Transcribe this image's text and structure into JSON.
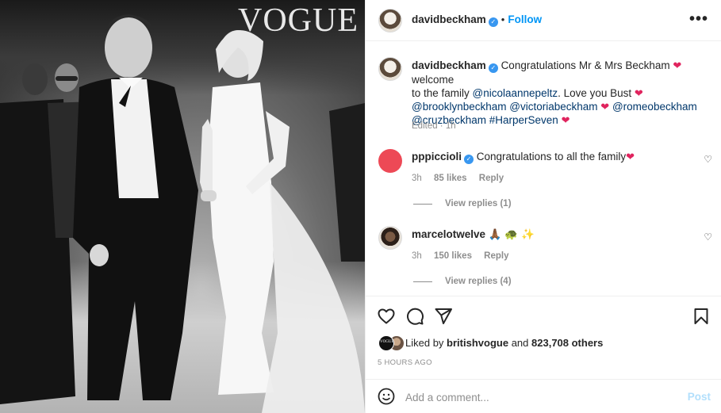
{
  "photo": {
    "watermark": "VOGUE"
  },
  "header": {
    "username": "davidbeckham",
    "separator": "•",
    "follow_label": "Follow",
    "more_label": "•••"
  },
  "caption": {
    "username": "davidbeckham",
    "text1": "Congratulations Mr & Mrs Beckham",
    "text2": "welcome",
    "text3": "to the family",
    "mention_nicola": "@nicolaannepeltz",
    "text4": ". Love you Bust",
    "mention_brooklyn": "@brooklynbeckham",
    "mention_victoria": "@victoriabeckham",
    "mention_romeo": "@romeobeckham",
    "mention_cruz": "@cruzbeckham",
    "hashtag_harper": "#HarperSeven",
    "edited": "Edited",
    "time": "1h",
    "heart": "❤"
  },
  "comments": [
    {
      "username": "pppiccioli",
      "text": "Congratulations to all the family",
      "time": "3h",
      "likes": "85 likes",
      "reply_label": "Reply",
      "view_replies": "View replies (1)"
    },
    {
      "username": "marcelotwelve",
      "text": "🙏🏾 🐢 ✨",
      "time": "3h",
      "likes": "150 likes",
      "reply_label": "Reply",
      "view_replies": "View replies (4)"
    }
  ],
  "likes": {
    "prefix": "Liked by",
    "user": "britishvogue",
    "and": "and",
    "others": "823,708 others",
    "avatar_label": "VOGUE"
  },
  "post_time": "5 HOURS AGO",
  "comment_box": {
    "placeholder": "Add a comment...",
    "post_label": "Post"
  },
  "colors": {
    "accent": "#0095f6",
    "verified": "#3897f0",
    "heart": "#e0245e",
    "post_disabled": "#b2dffc"
  }
}
